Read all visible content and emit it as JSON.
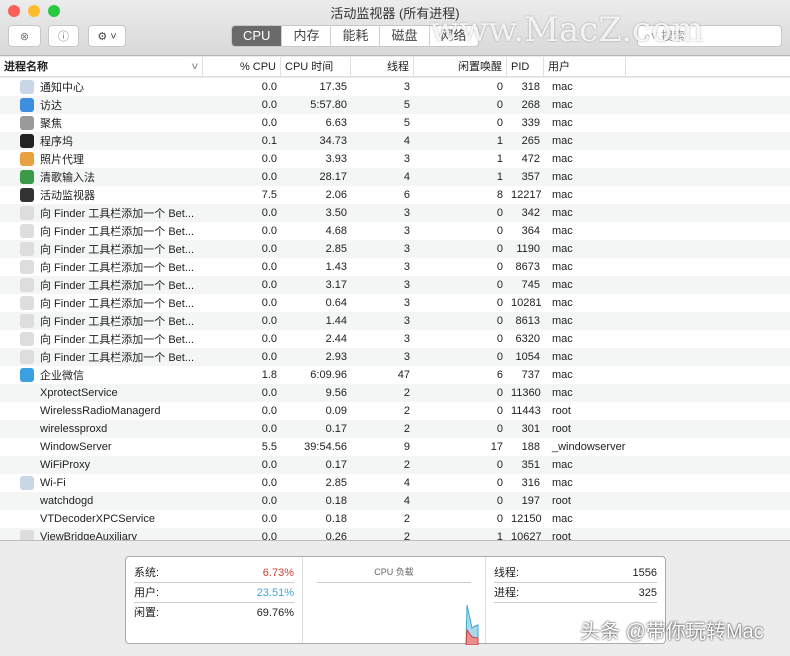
{
  "window": {
    "title": "活动监视器 (所有进程)"
  },
  "toolbar": {
    "tabs": [
      "CPU",
      "内存",
      "能耗",
      "磁盘",
      "网络"
    ],
    "active_tab": "CPU",
    "search_placeholder": "搜索"
  },
  "columns": [
    "进程名称",
    "% CPU",
    "CPU 时间",
    "线程",
    "闲置唤醒",
    "PID",
    "用户"
  ],
  "rows": [
    [
      "通知中心",
      "0.0",
      "17.35",
      "3",
      "0",
      "318",
      "mac",
      "#c8d6e8"
    ],
    [
      "访达",
      "0.0",
      "5:57.80",
      "5",
      "0",
      "268",
      "mac",
      "#3b8ee0"
    ],
    [
      "聚焦",
      "0.0",
      "6.63",
      "5",
      "0",
      "339",
      "mac",
      "#9a9a9a"
    ],
    [
      "程序坞",
      "0.1",
      "34.73",
      "4",
      "1",
      "265",
      "mac",
      "#222"
    ],
    [
      "照片代理",
      "0.0",
      "3.93",
      "3",
      "1",
      "472",
      "mac",
      "#e8a040"
    ],
    [
      "清歌输入法",
      "0.0",
      "28.17",
      "4",
      "1",
      "357",
      "mac",
      "#3a9a4a"
    ],
    [
      "活动监视器",
      "7.5",
      "2.06",
      "6",
      "8",
      "12217",
      "mac",
      "#333"
    ],
    [
      "向 Finder 工具栏添加一个 Bet...",
      "0.0",
      "3.50",
      "3",
      "0",
      "342",
      "mac",
      "#ddd"
    ],
    [
      "向 Finder 工具栏添加一个 Bet...",
      "0.0",
      "4.68",
      "3",
      "0",
      "364",
      "mac",
      "#ddd"
    ],
    [
      "向 Finder 工具栏添加一个 Bet...",
      "0.0",
      "2.85",
      "3",
      "0",
      "1190",
      "mac",
      "#ddd"
    ],
    [
      "向 Finder 工具栏添加一个 Bet...",
      "0.0",
      "1.43",
      "3",
      "0",
      "8673",
      "mac",
      "#ddd"
    ],
    [
      "向 Finder 工具栏添加一个 Bet...",
      "0.0",
      "3.17",
      "3",
      "0",
      "745",
      "mac",
      "#ddd"
    ],
    [
      "向 Finder 工具栏添加一个 Bet...",
      "0.0",
      "0.64",
      "3",
      "0",
      "10281",
      "mac",
      "#ddd"
    ],
    [
      "向 Finder 工具栏添加一个 Bet...",
      "0.0",
      "1.44",
      "3",
      "0",
      "8613",
      "mac",
      "#ddd"
    ],
    [
      "向 Finder 工具栏添加一个 Bet...",
      "0.0",
      "2.44",
      "3",
      "0",
      "6320",
      "mac",
      "#ddd"
    ],
    [
      "向 Finder 工具栏添加一个 Bet...",
      "0.0",
      "2.93",
      "3",
      "0",
      "1054",
      "mac",
      "#ddd"
    ],
    [
      "企业微信",
      "1.8",
      "6:09.96",
      "47",
      "6",
      "737",
      "mac",
      "#3aa0e0"
    ],
    [
      "XprotectService",
      "0.0",
      "9.56",
      "2",
      "0",
      "11360",
      "mac",
      ""
    ],
    [
      "WirelessRadioManagerd",
      "0.0",
      "0.09",
      "2",
      "0",
      "11443",
      "root",
      ""
    ],
    [
      "wirelessproxd",
      "0.0",
      "0.17",
      "2",
      "0",
      "301",
      "root",
      ""
    ],
    [
      "WindowServer",
      "5.5",
      "39:54.56",
      "9",
      "17",
      "188",
      "_windowserver",
      ""
    ],
    [
      "WiFiProxy",
      "0.0",
      "0.17",
      "2",
      "0",
      "351",
      "mac",
      ""
    ],
    [
      "Wi-Fi",
      "0.0",
      "2.85",
      "4",
      "0",
      "316",
      "mac",
      "#c8d6e8"
    ],
    [
      "watchdogd",
      "0.0",
      "0.18",
      "4",
      "0",
      "197",
      "root",
      ""
    ],
    [
      "VTDecoderXPCService",
      "0.0",
      "0.18",
      "2",
      "0",
      "12150",
      "mac",
      ""
    ],
    [
      "ViewBridgeAuxiliary",
      "0.0",
      "0.26",
      "2",
      "1",
      "10627",
      "root",
      "#ddd"
    ]
  ],
  "summary": {
    "system_label": "系统:",
    "system": "6.73%",
    "user_label": "用户:",
    "user": "23.51%",
    "idle_label": "闲置:",
    "idle": "69.76%",
    "chart_title": "CPU 负载",
    "threads_label": "线程:",
    "threads": "1556",
    "procs_label": "进程:",
    "procs": "325"
  },
  "colors": {
    "system": "#d0403a",
    "user": "#3aa8d0"
  },
  "watermarks": [
    "www.MacZ.com",
    "头条 @带你玩转Mac"
  ]
}
